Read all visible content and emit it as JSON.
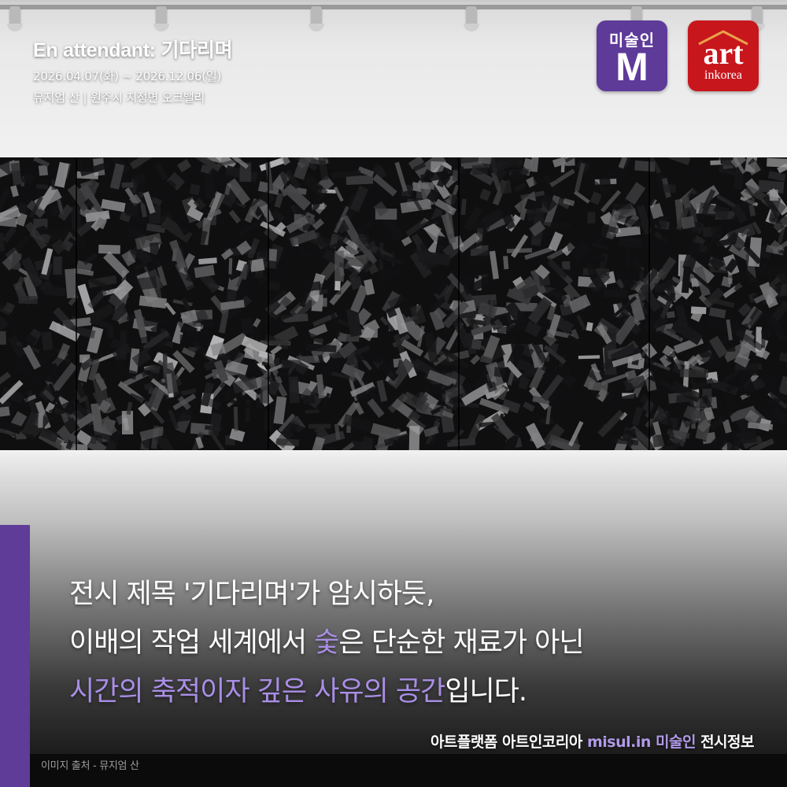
{
  "exhibition": {
    "title": "En attendant: 기다리며",
    "dates": "2026.04.07(화) ~ 2026.12.06(일)",
    "venue": "뮤지엄 산 | 원주시 지정면 오크밸리"
  },
  "logos": {
    "misulin": {
      "top": "미술인",
      "letter": "M",
      "color": "#5e3a99"
    },
    "artinkorea": {
      "top": "art",
      "bottom": "inkorea",
      "color": "#c8161d"
    }
  },
  "caption": {
    "line1": "전시 제목 '기다리며'가 암시하듯,",
    "line2_pre": "이배의 작업 세계에서 ",
    "line2_hl": "숯",
    "line2_post": "은 단순한 재료가 아닌",
    "line3_hl": "시간의 축적이자 깊은 사유의 공간",
    "line3_post": "입니다."
  },
  "credit": {
    "pre": "아트플랫폼 아트인코리아  ",
    "hl": "misul.in 미술인",
    "post": " 전시정보"
  },
  "source": "이미지 출처 - 뮤지엄 산",
  "colors": {
    "accent": "#5f3c97",
    "highlight": "#a98ee6"
  }
}
